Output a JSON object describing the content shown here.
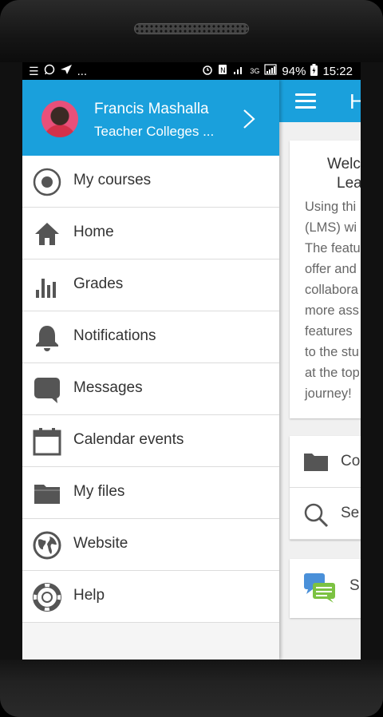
{
  "status_bar": {
    "left_icons": [
      "list-icon",
      "whatsapp-icon",
      "send-icon"
    ],
    "overflow": "...",
    "battery_level": "94%",
    "time": "15:22",
    "network": "3G"
  },
  "drawer": {
    "user": {
      "name": "Francis Mashalla",
      "subtitle": "Teacher Colleges ..."
    },
    "items": [
      {
        "label": "My courses",
        "icon": "target-icon"
      },
      {
        "label": "Home",
        "icon": "home-icon"
      },
      {
        "label": "Grades",
        "icon": "bar-chart-icon"
      },
      {
        "label": "Notifications",
        "icon": "bell-icon"
      },
      {
        "label": "Messages",
        "icon": "chat-bubble-icon"
      },
      {
        "label": "Calendar events",
        "icon": "calendar-icon"
      },
      {
        "label": "My files",
        "icon": "folder-icon"
      },
      {
        "label": "Website",
        "icon": "globe-icon"
      },
      {
        "label": "Help",
        "icon": "lifebuoy-icon"
      }
    ]
  },
  "background": {
    "header_title": "H",
    "welcome_title_lines": [
      "Welc",
      "Lea"
    ],
    "welcome_text_lines": [
      "Using thi",
      "(LMS) wi",
      "The featu",
      "offer and",
      "collabora",
      "more ass",
      "features",
      "to the stu",
      "at the top",
      "journey!"
    ],
    "menu": [
      {
        "label": "Co",
        "icon": "folder-icon"
      },
      {
        "label": "Se",
        "icon": "search-icon"
      }
    ],
    "site_label": "S",
    "site_icon": "chat-bubbles-icon"
  },
  "colors": {
    "accent": "#1aa0dc",
    "icon_gray": "#555555"
  }
}
